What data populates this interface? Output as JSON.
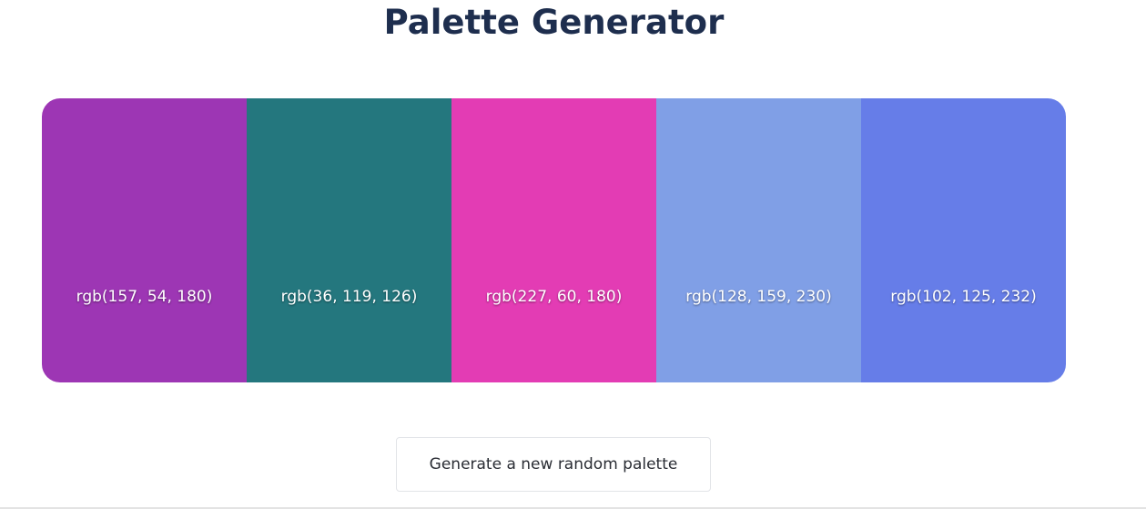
{
  "header": {
    "title": "Palette Generator"
  },
  "palette": {
    "swatches": [
      {
        "label": "rgb(157, 54, 180)",
        "color": "#9d36b4"
      },
      {
        "label": "rgb(36, 119, 126)",
        "color": "#24777e"
      },
      {
        "label": "rgb(227, 60, 180)",
        "color": "#e33cb4"
      },
      {
        "label": "rgb(128, 159, 230)",
        "color": "#809fe6"
      },
      {
        "label": "rgb(102, 125, 232)",
        "color": "#667de8"
      }
    ]
  },
  "actions": {
    "generate_label": "Generate a new random palette"
  },
  "colors": {
    "title": "#1e2e4e",
    "button_border": "#e2e4e8",
    "button_text": "#2a2d34"
  }
}
